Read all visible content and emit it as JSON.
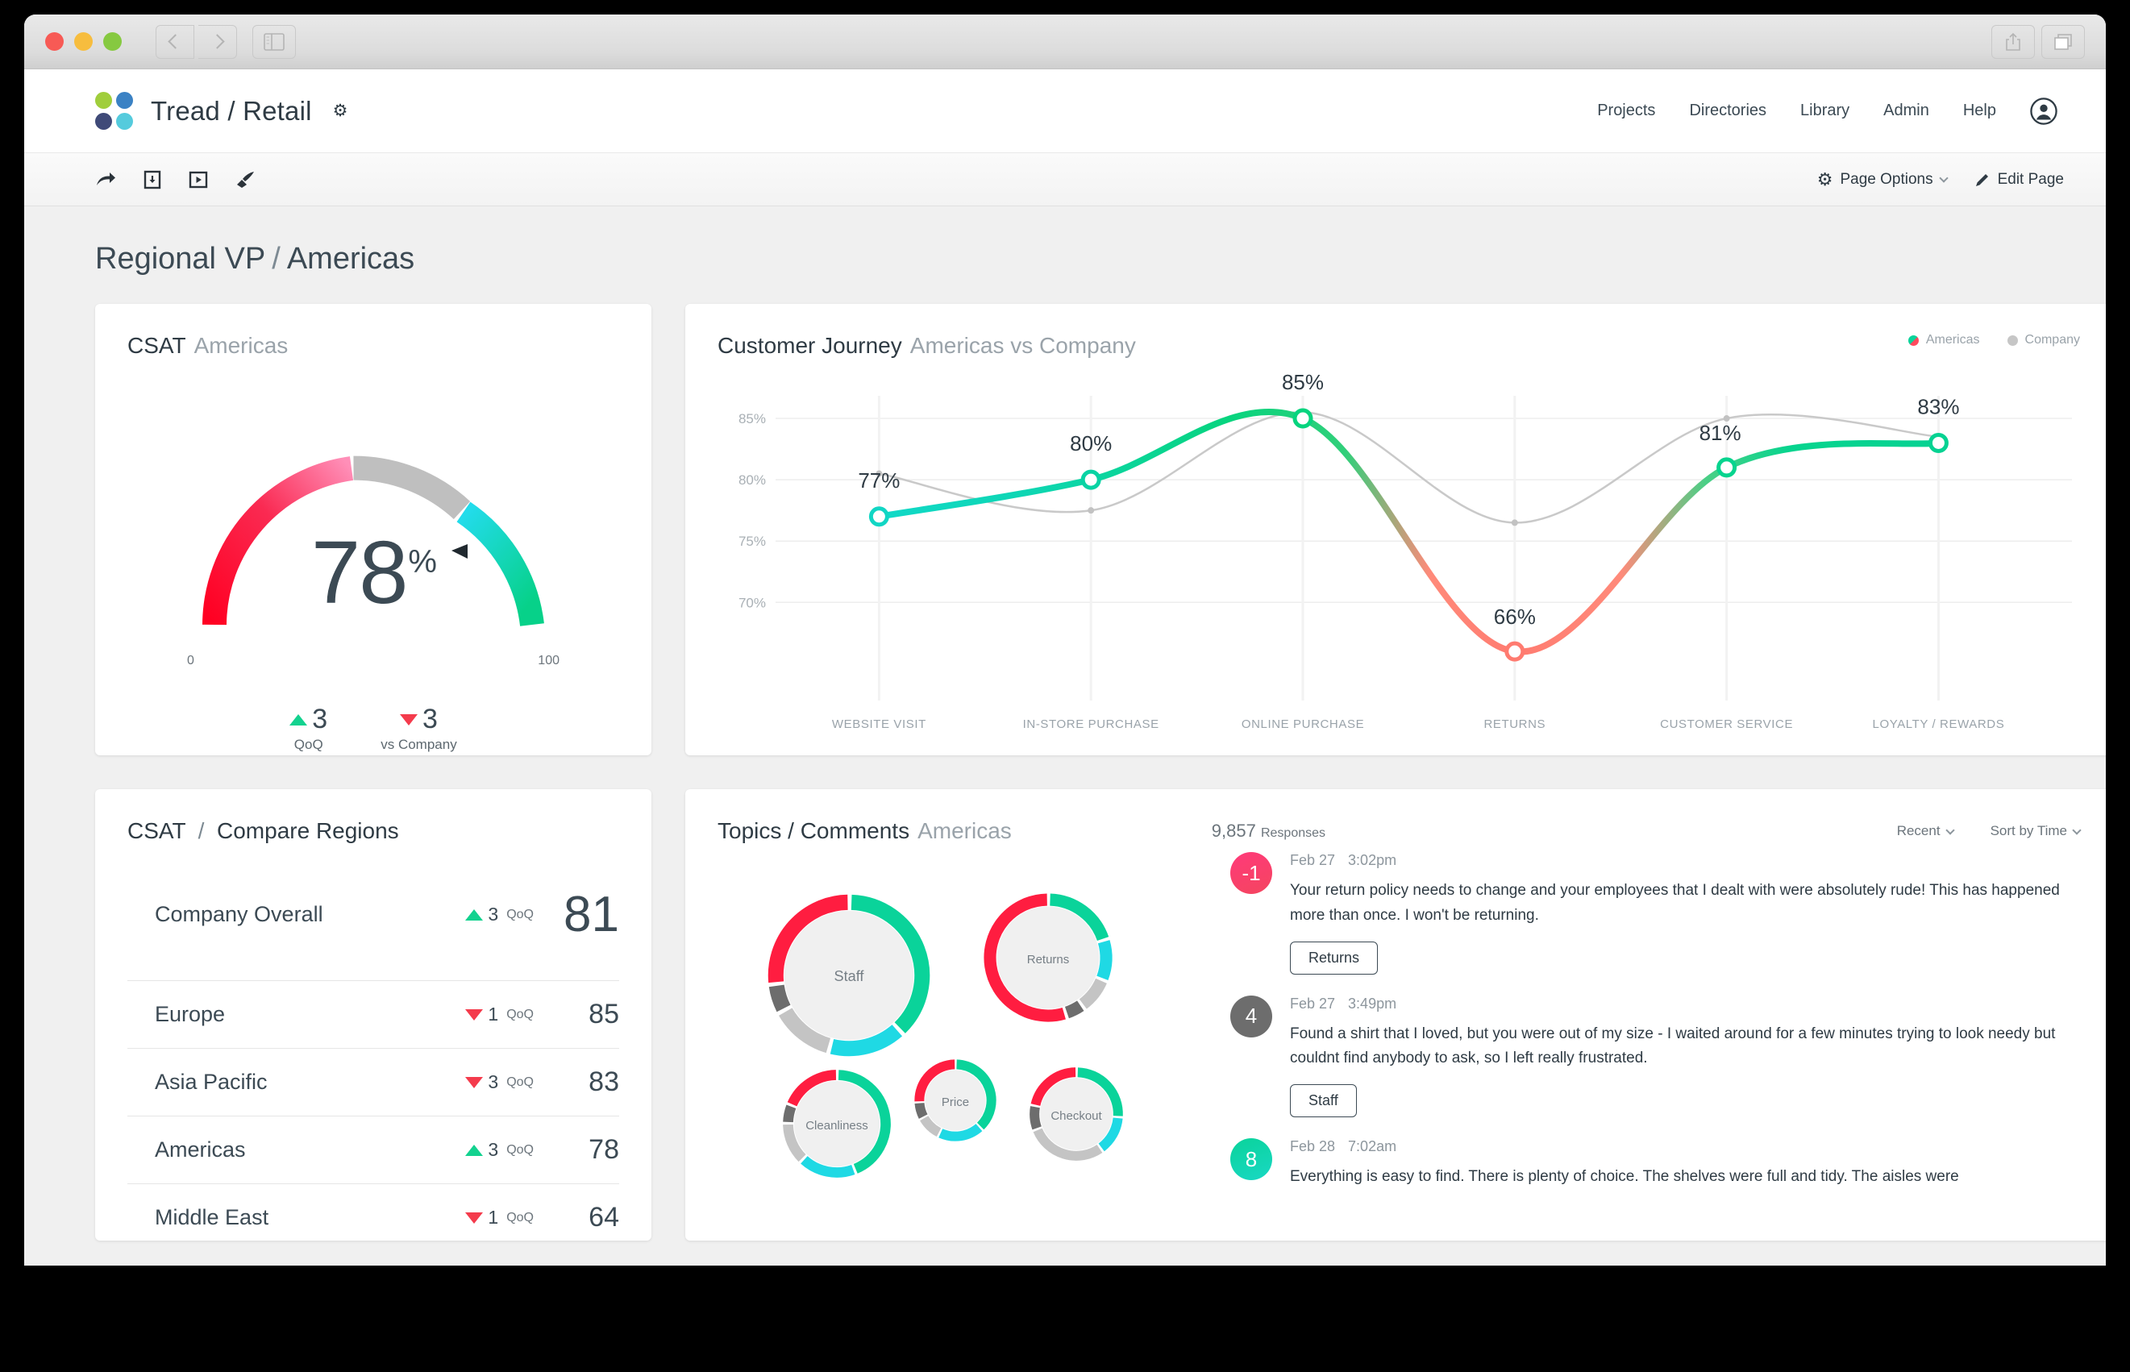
{
  "window": {
    "back_icon": "chevron-left-icon",
    "forward_icon": "chevron-right-icon",
    "sidebar_icon": "sidebar-toggle-icon",
    "share_icon": "share-icon",
    "tabs_icon": "tabs-icon"
  },
  "header": {
    "brand": "Tread / Retail",
    "brand_settings_icon": "gear-icon",
    "logo_colors": [
      "#a0ce3c",
      "#3b82c4",
      "#3f4a78",
      "#55cbdd"
    ],
    "nav": [
      {
        "label": "Projects"
      },
      {
        "label": "Directories"
      },
      {
        "label": "Library"
      },
      {
        "label": "Admin"
      },
      {
        "label": "Help"
      }
    ],
    "avatar_icon": "account-circle-icon"
  },
  "toolbar": {
    "icons": [
      "share-arrow-icon",
      "download-document-icon",
      "present-icon",
      "brush-icon"
    ],
    "page_options": "Page Options",
    "page_options_icon": "gear-icon",
    "edit_page": "Edit Page",
    "edit_page_icon": "pencil-icon"
  },
  "page": {
    "title_primary": "Regional VP",
    "title_sep": "/",
    "title_secondary": "Americas"
  },
  "gauge": {
    "title": "CSAT",
    "subtitle": "Americas",
    "value": "78",
    "unit": "%",
    "min_label": "0",
    "max_label": "100",
    "deltas": [
      {
        "direction": "up",
        "value": "3",
        "label": "QoQ"
      },
      {
        "direction": "down",
        "value": "3",
        "label": "vs Company"
      }
    ]
  },
  "journey": {
    "title": "Customer Journey",
    "subtitle": "Americas vs Company",
    "legend": [
      {
        "label": "Americas",
        "color": "#0ad39a"
      },
      {
        "label": "Company",
        "color": "#c6c6c6"
      }
    ]
  },
  "compare": {
    "title_primary": "CSAT",
    "title_sep": "/",
    "title_secondary": "Compare Regions",
    "qoq_label": "QoQ",
    "rows": [
      {
        "name": "Company Overall",
        "direction": "up",
        "delta": "3",
        "score": "81",
        "big": true
      },
      {
        "name": "Europe",
        "direction": "down",
        "delta": "1",
        "score": "85",
        "big": false
      },
      {
        "name": "Asia Pacific",
        "direction": "down",
        "delta": "3",
        "score": "83",
        "big": false
      },
      {
        "name": "Americas",
        "direction": "up",
        "delta": "3",
        "score": "78",
        "big": false
      },
      {
        "name": "Middle East",
        "direction": "down",
        "delta": "1",
        "score": "64",
        "big": false
      }
    ]
  },
  "topics": {
    "title": "Topics / Comments",
    "subtitle": "Americas",
    "responses_count": "9,857",
    "responses_label": "Responses",
    "filter_recent": "Recent",
    "sort_by": "Sort by Time",
    "bubbles": [
      {
        "label": "Staff"
      },
      {
        "label": "Returns"
      },
      {
        "label": "Cleanliness"
      },
      {
        "label": "Price"
      },
      {
        "label": "Checkout"
      }
    ],
    "comments": [
      {
        "score": "-1",
        "badge_color": "#f6426a",
        "date": "Feb 27",
        "time": "3:02pm",
        "text": "Your return policy needs to change and your employees that I dealt with were absolutely rude!  This has happened more than once.  I won't be returning.",
        "tag": "Returns"
      },
      {
        "score": "4",
        "badge_color": "#6d6d6d",
        "date": "Feb 27",
        "time": "3:49pm",
        "text": "Found a shirt that I loved, but you were out of my size - I waited around for a few minutes trying to look needy but couldnt find anybody to ask, so I left really frustrated.",
        "tag": "Staff"
      },
      {
        "score": "8",
        "badge_color": "#0ad39a",
        "date": "Feb 28",
        "time": "7:02am",
        "text": "Everything is easy to find. There is plenty of choice. The shelves were full and tidy. The aisles were",
        "tag": ""
      }
    ]
  },
  "chart_data": {
    "type": "line",
    "title": "Customer Journey",
    "subtitle": "Americas vs Company",
    "categories": [
      "WEBSITE VISIT",
      "IN-STORE PURCHASE",
      "ONLINE PURCHASE",
      "RETURNS",
      "CUSTOMER SERVICE",
      "LOYALTY / REWARDS"
    ],
    "series": [
      {
        "name": "Americas",
        "values": [
          77,
          80,
          85,
          66,
          81,
          83
        ],
        "labels": [
          "77%",
          "80%",
          "85%",
          "66%",
          "81%",
          "83%"
        ]
      },
      {
        "name": "Company",
        "values": [
          80.5,
          77.5,
          85.5,
          76.5,
          85,
          83.5
        ],
        "labels": []
      }
    ],
    "ylabel": "",
    "xlabel": "",
    "yticks": [
      85,
      80,
      75,
      70
    ],
    "ytick_labels": [
      "85%",
      "80%",
      "75%",
      "70%"
    ],
    "ylim": [
      66,
      87
    ],
    "grid": true,
    "legend_position": "top-right"
  },
  "gauge_chart": {
    "type": "gauge",
    "value": 78,
    "min": 0,
    "max": 100,
    "bands": [
      {
        "from": 0,
        "to": 45,
        "color_from": "#ff0022",
        "color_to": "#ff8fb2"
      },
      {
        "from": 45,
        "to": 68,
        "color": "#bfbfbf"
      },
      {
        "from": 68,
        "to": 100,
        "color_from": "#1fe0e8",
        "color_to": "#0ad18c"
      }
    ],
    "needle": 78
  },
  "bubbles_chart": {
    "type": "pie",
    "items": [
      {
        "label": "Staff",
        "radius": 126,
        "segments": [
          38,
          16,
          13,
          6,
          27
        ]
      },
      {
        "label": "Returns",
        "radius": 100,
        "segments": [
          20,
          11,
          9,
          5,
          55
        ]
      },
      {
        "label": "Cleanliness",
        "radius": 84,
        "segments": [
          44,
          18,
          13,
          6,
          19
        ]
      },
      {
        "label": "Price",
        "radius": 62,
        "segments": [
          38,
          19,
          10,
          7,
          26
        ]
      },
      {
        "label": "Checkout",
        "radius": 72,
        "segments": [
          26,
          14,
          29,
          9,
          22
        ]
      }
    ],
    "segment_colors": [
      "#0ad39a",
      "#1fd9e4",
      "#c4c4c4",
      "#6d6d6d",
      "#ff1d40"
    ]
  }
}
